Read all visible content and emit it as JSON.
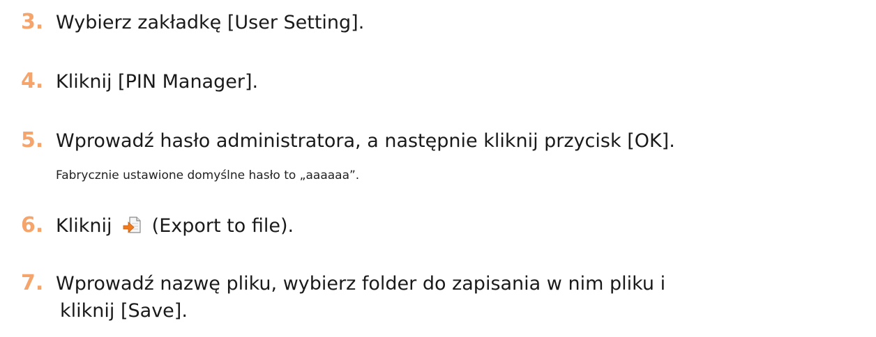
{
  "steps": [
    {
      "number": "3.",
      "text": "Wybierz zakładkę [User Setting]."
    },
    {
      "number": "4.",
      "text": "Kliknij [PIN Manager]."
    },
    {
      "number": "5.",
      "text": "Wprowadź hasło administratora, a następnie kliknij przycisk [OK].",
      "note": "Fabrycznie ustawione domyślne hasło to „aaaaaa”."
    },
    {
      "number": "6.",
      "text_before": "Kliknij",
      "icon": "export-to-file-icon",
      "text_after": "(Export to file)."
    },
    {
      "number": "7.",
      "text": "Wprowadź nazwę pliku, wybierz folder do zapisania w nim pliku i",
      "continuation": "kliknij [Save]."
    }
  ],
  "colors": {
    "step_number": "#f5a46c",
    "text": "#1a1a1a"
  }
}
